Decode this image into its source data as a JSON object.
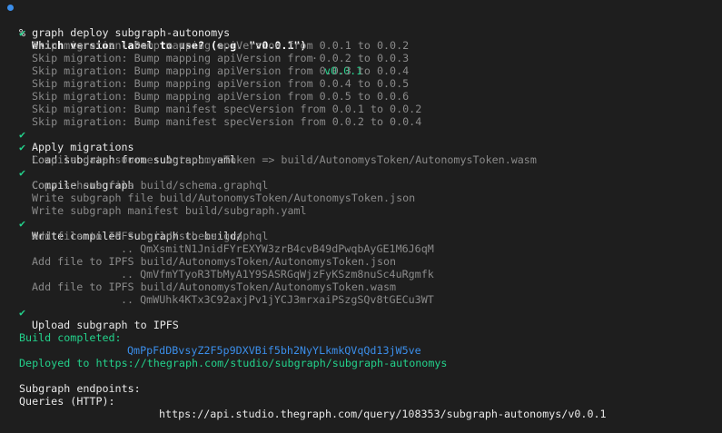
{
  "terminal": {
    "command": "% graph deploy subgraph-autonomys",
    "question": {
      "prompt": "Which version label to use? (e.g. \"v0.0.1\")",
      "separator": "·",
      "answer": "v0.0.1"
    },
    "skip_lines": [
      "Skip migration: Bump mapping apiVersion from 0.0.1 to 0.0.2",
      "Skip migration: Bump mapping apiVersion from 0.0.2 to 0.0.3",
      "Skip migration: Bump mapping apiVersion from 0.0.3 to 0.0.4",
      "Skip migration: Bump mapping apiVersion from 0.0.4 to 0.0.5",
      "Skip migration: Bump mapping apiVersion from 0.0.5 to 0.0.6",
      "Skip migration: Bump manifest specVersion from 0.0.1 to 0.0.2",
      "Skip migration: Bump manifest specVersion from 0.0.2 to 0.0.4"
    ],
    "check_mark": "✔",
    "apply_migrations": "Apply migrations",
    "load_subgraph": "Load subgraph from subgraph.yaml",
    "compile_data_source": "Compile data source: AutonomysToken => build/AutonomysToken/AutonomysToken.wasm",
    "compile_subgraph": "Compile subgraph",
    "copy_schema": "Copy schema file build/schema.graphql",
    "write_subgraph_file": "Write subgraph file build/AutonomysToken/AutonomysToken.json",
    "write_manifest": "Write subgraph manifest build/subgraph.yaml",
    "write_compiled": "Write compiled subgraph to build/",
    "ipfs_1": "Add file to IPFS build/schema.graphql",
    "ipfs_1_hash": ".. QmXsmitN1JnidFYrEXYW3zrB4cvB49dPwqbAyGE1M6J6qM",
    "ipfs_2": "Add file to IPFS build/AutonomysToken/AutonomysToken.json",
    "ipfs_2_hash": ".. QmVfmYTyoR3TbMyA1Y9SASRGqWjzFyKSzm8nuSc4uRgmfk",
    "ipfs_3": "Add file to IPFS build/AutonomysToken/AutonomysToken.wasm",
    "ipfs_3_hash": ".. QmWUhk4KTx3C92axjPv1jYCJ3mrxaiPSzgSQv8tGECu3WT",
    "upload": "Upload subgraph to IPFS",
    "build_completed_label": "Build completed:",
    "build_hash": "QmPpFdDBvsyZ2F5p9DXVBif5bh2NyYLkmkQVqQd13jW5ve",
    "deployed": "Deployed to https://thegraph.com/studio/subgraph/subgraph-autonomys",
    "endpoints_title": "Subgraph endpoints:",
    "queries_label": "Queries (HTTP):",
    "queries_url": "https://api.studio.thegraph.com/query/108353/subgraph-autonomys/v0.0.1"
  },
  "colors": {
    "background": "#1e1e1e",
    "success": "#23d18b",
    "link": "#3b8eea",
    "dim": "#8a8a8a"
  }
}
